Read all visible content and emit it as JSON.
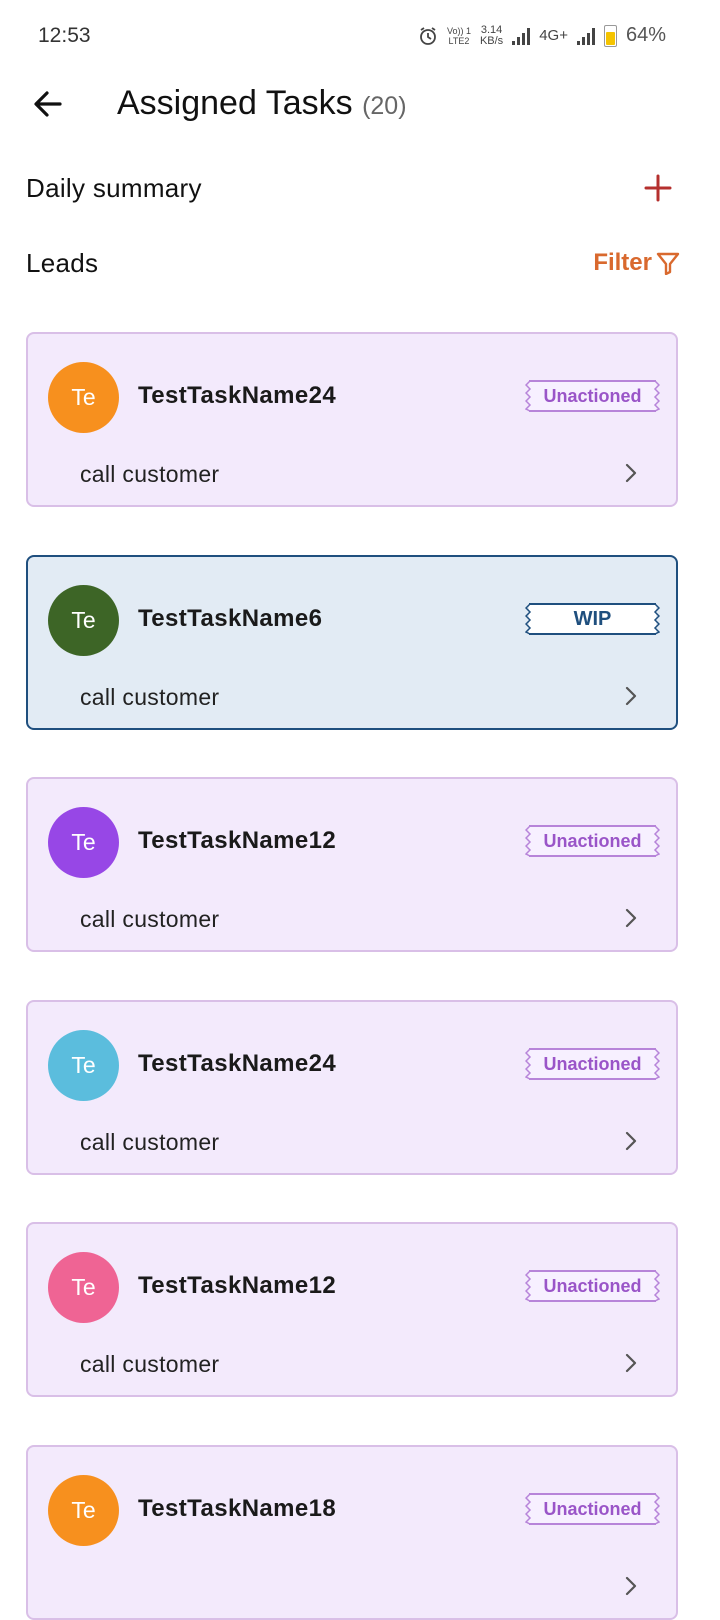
{
  "status_bar": {
    "time": "12:53",
    "volte_top": "Vo)) 1",
    "volte_bottom": "LTE2",
    "speed_top": "3.14",
    "speed_bottom": "KB/s",
    "network": "4G+",
    "battery_percent": "64%",
    "battery_level": 0.64
  },
  "header": {
    "title": "Assigned Tasks",
    "count": "(20)"
  },
  "daily_summary": {
    "label": "Daily summary"
  },
  "leads": {
    "label": "Leads",
    "filter_label": "Filter"
  },
  "colors": {
    "accent_red": "#b5302e",
    "filter_orange": "#d9692e",
    "unactioned_purple": "#9a55c8",
    "wip_blue": "#1f4f7e"
  },
  "tasks": [
    {
      "initials": "Te",
      "name": "TestTaskName24",
      "status": "Unactioned",
      "description": "call customer",
      "avatar_color": "#f7901e"
    },
    {
      "initials": "Te",
      "name": "TestTaskName6",
      "status": "WIP",
      "description": "call customer",
      "avatar_color": "#3d6526"
    },
    {
      "initials": "Te",
      "name": "TestTaskName12",
      "status": "Unactioned",
      "description": "call customer",
      "avatar_color": "#9747e6"
    },
    {
      "initials": "Te",
      "name": "TestTaskName24",
      "status": "Unactioned",
      "description": "call customer",
      "avatar_color": "#5bbddd"
    },
    {
      "initials": "Te",
      "name": "TestTaskName12",
      "status": "Unactioned",
      "description": "call customer",
      "avatar_color": "#ef6494"
    },
    {
      "initials": "Te",
      "name": "TestTaskName18",
      "status": "Unactioned",
      "description": "",
      "avatar_color": "#f7901e"
    }
  ]
}
